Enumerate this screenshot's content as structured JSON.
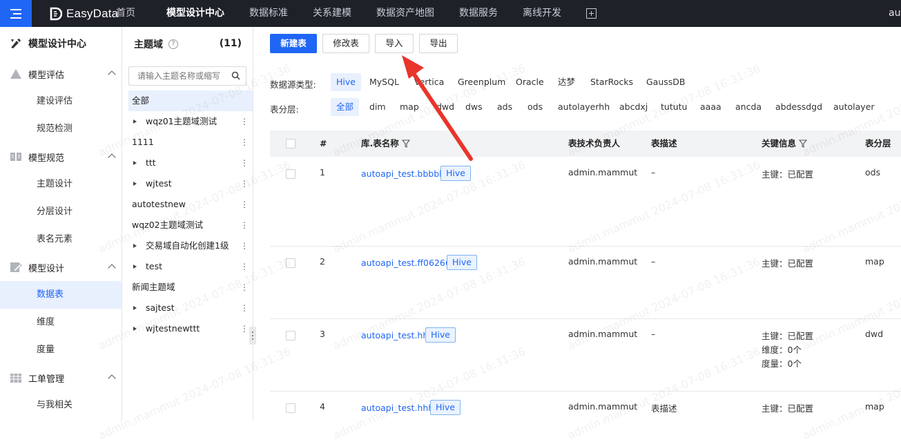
{
  "topnav": {
    "logo": "EasyData",
    "items": [
      "首页",
      "模型设计中心",
      "数据标准",
      "关系建模",
      "数据资产地图",
      "数据服务",
      "离线开发"
    ],
    "active": "模型设计中心",
    "user": "aut"
  },
  "sidebar": {
    "title": "模型设计中心",
    "groups": [
      {
        "label": "模型评估",
        "items": [
          "建设评估",
          "规范检测"
        ]
      },
      {
        "label": "模型规范",
        "items": [
          "主题设计",
          "分层设计",
          "表名元素"
        ]
      },
      {
        "label": "模型设计",
        "items": [
          "数据表",
          "维度",
          "度量"
        ]
      },
      {
        "label": "工单管理",
        "items": [
          "与我相关"
        ]
      }
    ],
    "active_item": "数据表"
  },
  "domain_panel": {
    "title": "主题域",
    "help": "?",
    "count": "(11)",
    "search_placeholder": "请输入主题名称或缩写",
    "items": [
      {
        "label": "全部",
        "expandable": false
      },
      {
        "label": "wqz01主题域测试",
        "expandable": true
      },
      {
        "label": "1111",
        "expandable": false
      },
      {
        "label": "ttt",
        "expandable": true
      },
      {
        "label": "wjtest",
        "expandable": true
      },
      {
        "label": "autotestnew",
        "expandable": false
      },
      {
        "label": "wqz02主题域测试",
        "expandable": false
      },
      {
        "label": "交易域自动化创建1级",
        "expandable": true
      },
      {
        "label": "test",
        "expandable": true
      },
      {
        "label": "新闻主题域",
        "expandable": false
      },
      {
        "label": "sajtest",
        "expandable": true
      },
      {
        "label": "wjtestnewttt",
        "expandable": true
      }
    ],
    "more_icon": "⋮"
  },
  "toolbar": {
    "new_table": "新建表",
    "edit_table": "修改表",
    "import": "导入",
    "export": "导出"
  },
  "filters": {
    "datasource_label": "数据源类型:",
    "datasources": [
      "Hive",
      "MySQL",
      "Vertica",
      "Greenplum",
      "Oracle",
      "达梦",
      "StarRocks",
      "GaussDB"
    ],
    "datasource_active": "Hive",
    "layer_label": "表分层:",
    "layers": [
      "全部",
      "dim",
      "map",
      "dwd",
      "dws",
      "ads",
      "ods",
      "autolayerhh",
      "abcdxj",
      "tututu",
      "aaaa",
      "ancda",
      "abdessdgd",
      "autolayer"
    ],
    "layer_active": "全部"
  },
  "table": {
    "headers": [
      "#",
      "库.表名称",
      "表技术负责人",
      "表描述",
      "关键信息",
      "表分层"
    ],
    "rows": [
      {
        "index": "1",
        "name": "autoapi_test.bbbbb",
        "type": "Hive",
        "owner": "admin.mammut",
        "desc": "–",
        "key_info": [
          "主键：已配置"
        ],
        "layer": "ods"
      },
      {
        "index": "2",
        "name": "autoapi_test.ff06266",
        "type": "Hive",
        "owner": "admin.mammut",
        "desc": "–",
        "key_info": [
          "主键：已配置"
        ],
        "layer": "map"
      },
      {
        "index": "3",
        "name": "autoapi_test.hh",
        "type": "Hive",
        "owner": "admin.mammut",
        "desc": "–",
        "key_info": [
          "主键：已配置",
          "维度：0个",
          "度量：0个"
        ],
        "layer": "dwd"
      },
      {
        "index": "4",
        "name": "autoapi_test.hhh",
        "type": "Hive",
        "owner": "admin.mammut",
        "desc": "表描述",
        "key_info": [
          "主键：已配置"
        ],
        "layer": "map"
      }
    ]
  },
  "watermark": "admin.mammut 2024-07-08 16:31:36",
  "colors": {
    "primary": "#1f66f5",
    "topbar": "#1f2129",
    "arrow": "#e8352b",
    "selected_bg": "#e8f0fe"
  }
}
